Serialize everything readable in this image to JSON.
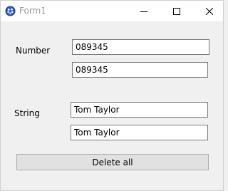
{
  "window": {
    "title": "Form1",
    "icon": "app-icon",
    "controls": [
      "minimize-icon",
      "maximize-icon",
      "close-icon"
    ]
  },
  "form": {
    "number_label": "Number",
    "number_field_1": "089345",
    "number_field_2": "089345",
    "string_label": "String",
    "string_field_1": "Tom Taylor",
    "string_field_2": "Tom Taylor",
    "delete_button_label": "Delete all"
  },
  "colors": {
    "window_bg": "#f0f0f0",
    "titlebar_bg": "#ffffff",
    "title_text": "#9a9a9a",
    "button_bg": "#e1e1e1",
    "button_border": "#adadad",
    "textbox_border": "#7a7a7a"
  }
}
